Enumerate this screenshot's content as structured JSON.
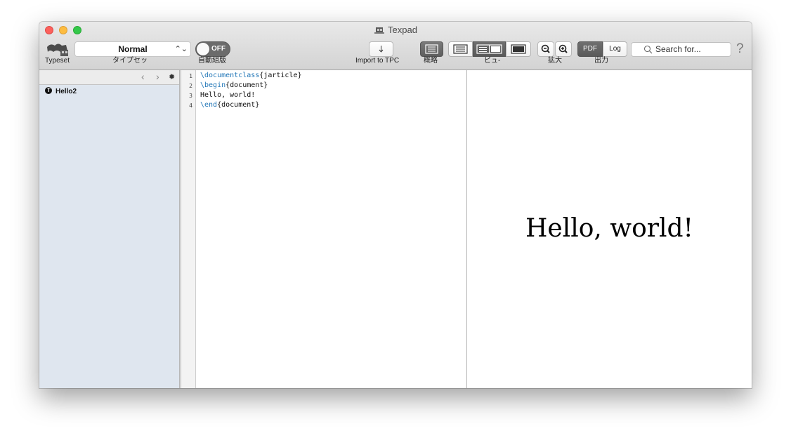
{
  "window": {
    "title": "Texpad"
  },
  "toolbar": {
    "typeset_label": "Typeset",
    "typeset_mode": "Normal",
    "typeset_mode_label": "タイプセッ",
    "auto_typeset_state": "OFF",
    "auto_typeset_label": "自動組版",
    "import_label": "Import to TPC",
    "outline_label": "概略",
    "view_label": "ビュ-",
    "zoom_label": "拡大",
    "pdf_label": "PDF",
    "log_label": "Log",
    "output_label": "出力",
    "search_placeholder": "Search for...",
    "help_glyph": "?"
  },
  "sidebar": {
    "items": [
      {
        "label": "Hello2"
      }
    ]
  },
  "editor": {
    "lines": [
      {
        "number": "1",
        "command": "\\documentclass",
        "arg": "{jarticle}"
      },
      {
        "number": "2",
        "command": "\\begin",
        "arg": "{document}"
      },
      {
        "number": "3",
        "command": "",
        "arg": "Hello, world!"
      },
      {
        "number": "4",
        "command": "\\end",
        "arg": "{document}"
      }
    ]
  },
  "preview": {
    "text": "Hello, world!"
  },
  "colors": {
    "close": "#fc605c",
    "minimize": "#fdbc40",
    "zoom": "#34c84a",
    "keyword": "#2478b8",
    "sidebar_bg": "#dfe6ef"
  }
}
